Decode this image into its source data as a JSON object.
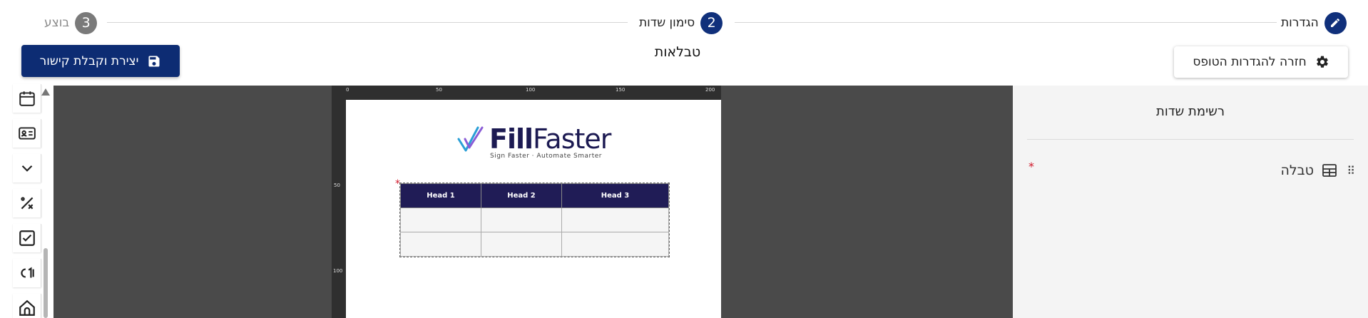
{
  "stepper": {
    "steps": [
      {
        "number": "",
        "label": "הגדרות",
        "icon": "pencil-icon"
      },
      {
        "number": "2",
        "label": "סימון שדות"
      },
      {
        "number": "3",
        "label": "בוצע"
      }
    ]
  },
  "header": {
    "title": "טבלאות",
    "primary_button": {
      "label": "יצירת וקבלת קישור",
      "icon": "save-icon"
    },
    "secondary_button": {
      "label": "חזרה להגדרות הטופס",
      "icon": "gear-icon"
    }
  },
  "toolbar": {
    "tools": [
      "calendar-icon",
      "id-card-icon",
      "chevron-down-icon",
      "percent-icon",
      "checkbox-icon",
      "number-field-icon",
      "home-icon"
    ]
  },
  "document": {
    "ruler_top": [
      "0",
      "50",
      "100",
      "150",
      "200"
    ],
    "ruler_left": [
      "50",
      "100"
    ],
    "logo": {
      "brand_bold": "Fill",
      "brand_light": "Faster",
      "tagline": "Sign Faster · Automate Smarter"
    },
    "required_mark": "*",
    "table": {
      "headers": [
        "Head 1",
        "Head 2",
        "Head 3"
      ],
      "rows": [
        [
          "",
          "",
          ""
        ],
        [
          "",
          "",
          ""
        ]
      ]
    }
  },
  "panel": {
    "title": "רשימת שדות",
    "fields": [
      {
        "label": "טבלה",
        "icon": "table-icon",
        "required": "*"
      }
    ]
  },
  "colors": {
    "primary": "#0d2c73",
    "table_header": "#201c56",
    "required": "#d0182a",
    "canvas": "#4a4a4a"
  }
}
